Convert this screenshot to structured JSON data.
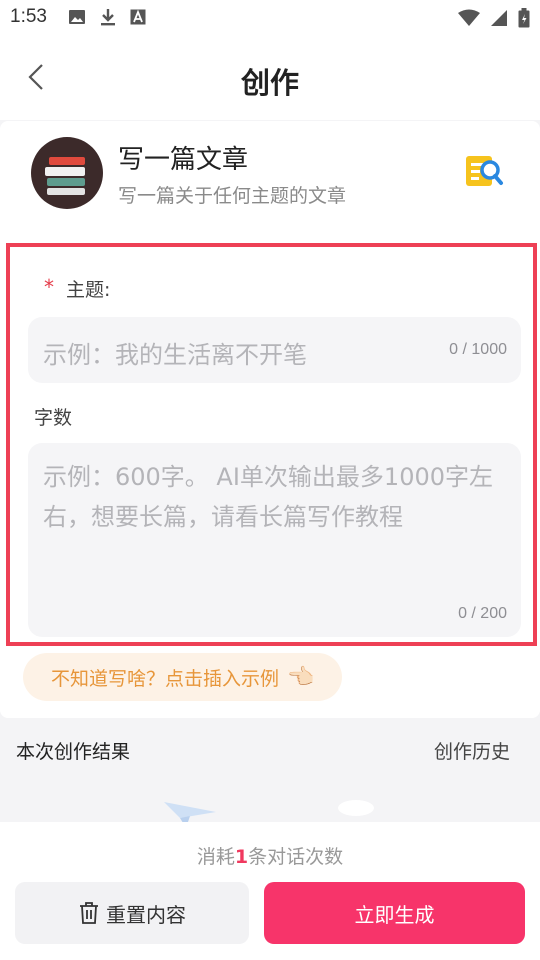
{
  "status": {
    "time": "1:53"
  },
  "header": {
    "title": "创作"
  },
  "tool": {
    "title": "写一篇文章",
    "subtitle": "写一篇关于任何主题的文章"
  },
  "form": {
    "topic_required_mark": "*",
    "topic_label": "主题:",
    "topic_placeholder": "示例：我的生活离不开笔",
    "topic_count": "0 / 1000",
    "words_label": "字数",
    "words_placeholder": "示例：600字。 AI单次输出最多1000字左右，想要长篇，请看长篇写作教程",
    "words_count": "0 / 200"
  },
  "hint": {
    "text": "不知道写啥？点击插入示例",
    "emoji": "👈🏻"
  },
  "result": {
    "title": "本次创作结果",
    "history": "创作历史"
  },
  "footer": {
    "consume_prefix": "消耗",
    "consume_num": "1",
    "consume_suffix": "条对话次数",
    "reset_label": "重置内容",
    "generate_label": "立即生成"
  },
  "colors": {
    "accent": "#f7346a",
    "highlight_border": "#ee4055",
    "hint": "#e7963a"
  }
}
